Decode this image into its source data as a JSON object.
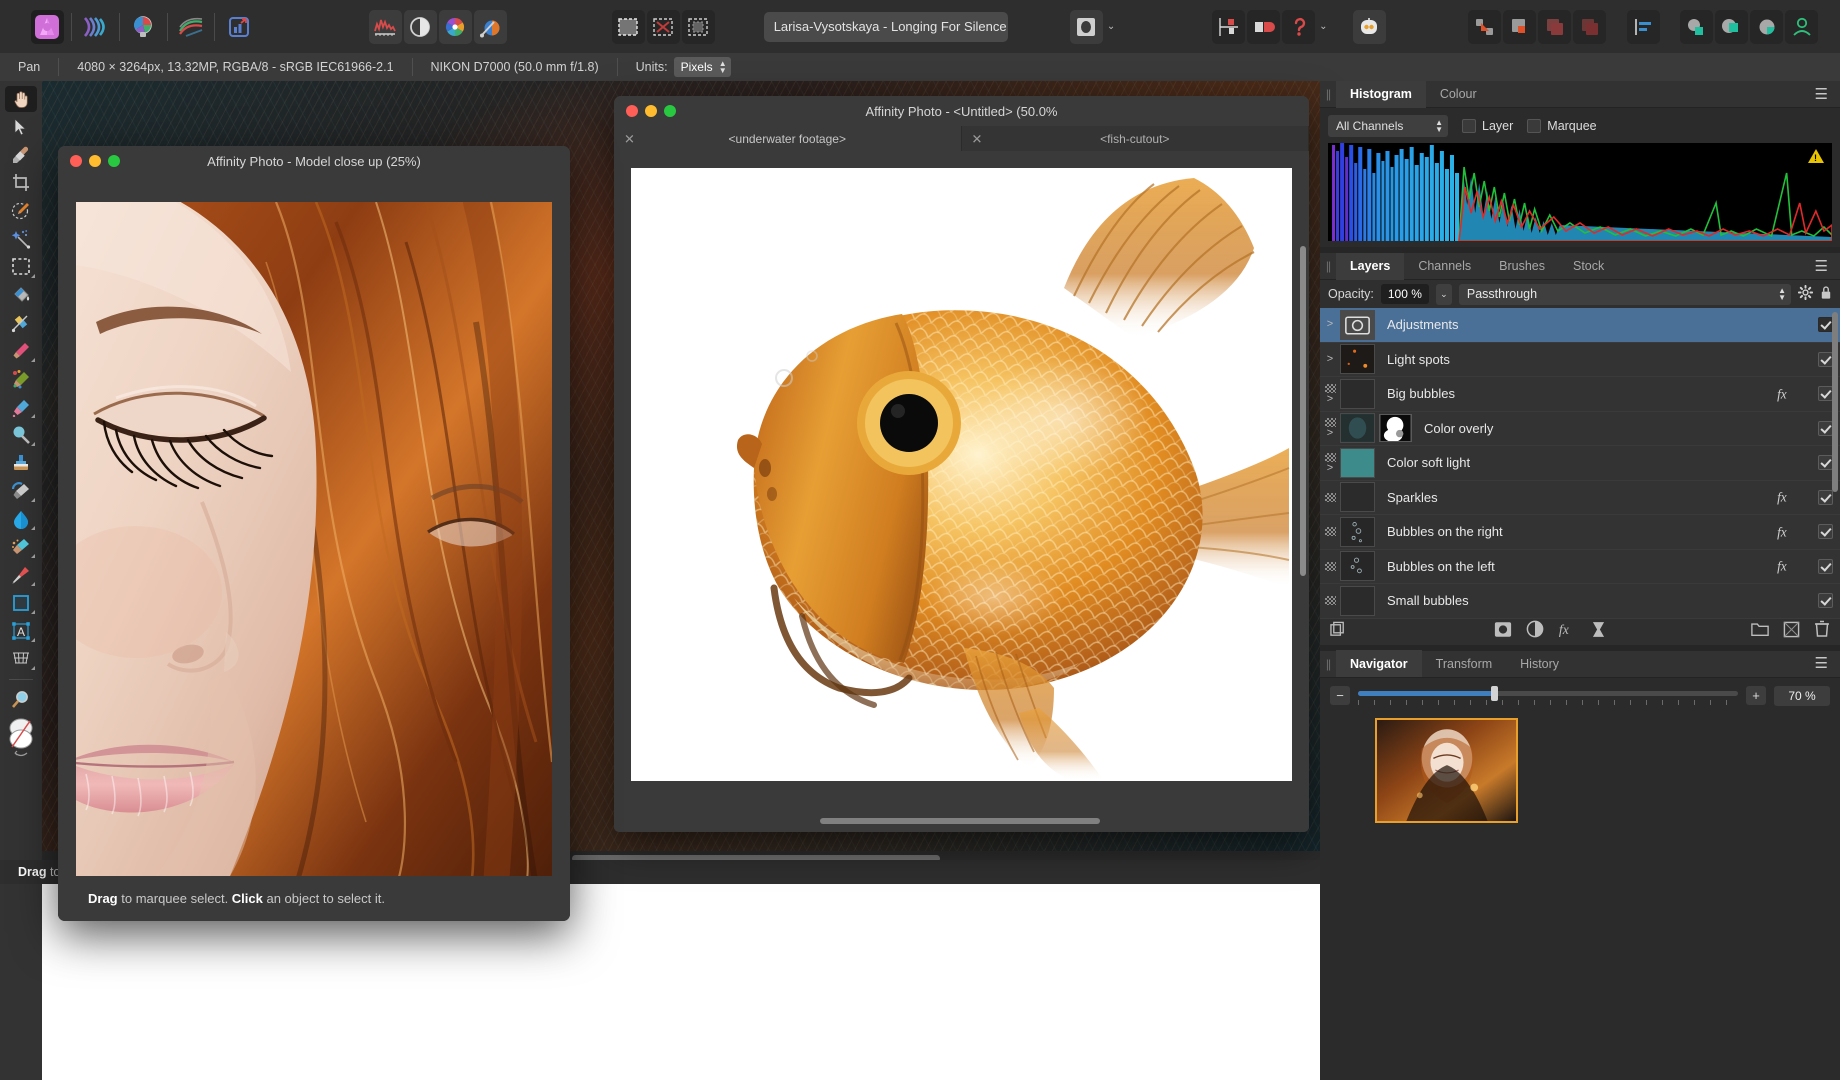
{
  "app": {
    "name": "Affinity Photo"
  },
  "toolbar": {
    "persona_icons": [
      "affinity-photo-persona",
      "liquify-persona",
      "develop-persona",
      "tone-mapping-persona",
      "export-persona"
    ],
    "studio_icons": [
      "histogram-icon",
      "adjustment-icon",
      "colour-wheel-icon",
      "colour-picker-icon"
    ],
    "selection_icons": [
      "select-all-icon",
      "deselect-icon",
      "invert-selection-icon"
    ],
    "document_chip": {
      "label": "Larisa-Vysotskaya - Longing For Silence (",
      "modified_marker": "✱"
    },
    "blend_icon": "blend-ranges-icon",
    "arrange_icons": [
      "snapping-icon",
      "contrast-icon",
      "assistant-icon"
    ],
    "assistant_icon": "assistant-robot-icon",
    "boolean_icons": [
      "align-icon",
      "combine-icon",
      "subtract-icon",
      "intersect-icon"
    ],
    "distribute_icon": "distribute-icon",
    "geometry_icons": [
      "add-geometry-icon",
      "subtract-geometry-icon",
      "divide-geometry-icon"
    ],
    "account_icon": "account-person-icon"
  },
  "context_bar": {
    "tool_name": "Pan",
    "document_info": "4080 × 3264px, 13.32MP, RGBA/8 - sRGB IEC61966-2.1",
    "camera_info": "NIKON D7000 (50.0 mm f/1.8)",
    "units_label": "Units:",
    "units_value": "Pixels"
  },
  "tools": [
    {
      "name": "view-pan-tool",
      "selected": true
    },
    {
      "name": "move-tool",
      "selected": false
    },
    {
      "name": "colour-picker-tool",
      "selected": false
    },
    {
      "name": "crop-tool",
      "selected": false
    },
    {
      "name": "selection-brush-tool",
      "selected": false
    },
    {
      "name": "flood-select-tool",
      "selected": false
    },
    {
      "name": "marquee-selection-tool",
      "selected": false
    },
    {
      "name": "flood-fill-tool",
      "selected": false
    },
    {
      "name": "gradient-tool",
      "selected": false
    },
    {
      "name": "paint-brush-tool",
      "selected": false
    },
    {
      "name": "paint-mixer-brush-tool",
      "selected": false
    },
    {
      "name": "erase-brush-tool",
      "selected": false
    },
    {
      "name": "dodge-brush-tool",
      "selected": false
    },
    {
      "name": "clone-brush-tool",
      "selected": false
    },
    {
      "name": "smudge-brush-tool",
      "selected": false
    },
    {
      "name": "blur-brush-tool",
      "selected": false
    },
    {
      "name": "sponge-brush-tool",
      "selected": false
    },
    {
      "name": "pen-tool",
      "selected": false
    },
    {
      "name": "rectangle-tool",
      "selected": false
    },
    {
      "name": "artistic-text-tool",
      "selected": false
    },
    {
      "name": "mesh-warp-tool",
      "selected": false
    },
    {
      "name": "zoom-tool",
      "selected": false
    },
    {
      "name": "colour-swatch-tool",
      "selected": false
    }
  ],
  "app_status": {
    "hint": "Drag to p"
  },
  "windows": {
    "model": {
      "title": "Affinity Photo - Model close up (25%)",
      "zoom": "25%",
      "status_strong_1": "Drag",
      "status_text_1": " to marquee select. ",
      "status_strong_2": "Click",
      "status_text_2": " an object to select it."
    },
    "fish": {
      "title": "Affinity Photo - <Untitled> (50.0%",
      "tabs": [
        {
          "label": "<underwater footage>",
          "active": true
        },
        {
          "label": "<fish-cutout>",
          "active": false
        }
      ]
    }
  },
  "right_panel": {
    "histogram_panel": {
      "tabs": [
        {
          "label": "Histogram",
          "active": true
        },
        {
          "label": "Colour",
          "active": false
        }
      ],
      "channel_select": "All Channels",
      "checkboxes": [
        {
          "label": "Layer",
          "checked": false
        },
        {
          "label": "Marquee",
          "checked": false
        }
      ],
      "warning_icon": "clipping-warning-icon",
      "menu_icon": "panel-menu-icon"
    },
    "layers_panel": {
      "tabs": [
        {
          "label": "Layers",
          "active": true
        },
        {
          "label": "Channels",
          "active": false
        },
        {
          "label": "Brushes",
          "active": false
        },
        {
          "label": "Stock",
          "active": false
        }
      ],
      "opacity_label": "Opacity:",
      "opacity_value": "100 %",
      "blend_mode": "Passthrough",
      "gear_icon": "layer-settings-icon",
      "lock_icon": "lock-icon",
      "menu_icon": "panel-menu-icon",
      "layers": [
        {
          "name": "Adjustments",
          "selected": true,
          "visible": true,
          "fx": false,
          "expandable": true,
          "masked": false,
          "thumb": "adjustment",
          "extra_thumb": false
        },
        {
          "name": "Light spots",
          "selected": false,
          "visible": true,
          "fx": false,
          "expandable": true,
          "masked": false,
          "thumb": "lightspots",
          "extra_thumb": false
        },
        {
          "name": "Big bubbles",
          "selected": false,
          "visible": true,
          "fx": true,
          "expandable": true,
          "masked": true,
          "thumb": "dark",
          "extra_thumb": false
        },
        {
          "name": "Color overly",
          "selected": false,
          "visible": true,
          "fx": false,
          "expandable": true,
          "masked": true,
          "thumb": "teal-dark",
          "extra_thumb": true
        },
        {
          "name": "Color soft light",
          "selected": false,
          "visible": true,
          "fx": false,
          "expandable": true,
          "masked": true,
          "thumb": "teal",
          "extra_thumb": false
        },
        {
          "name": "Sparkles",
          "selected": false,
          "visible": true,
          "fx": true,
          "expandable": false,
          "masked": true,
          "thumb": "dark",
          "extra_thumb": false
        },
        {
          "name": "Bubbles on the right",
          "selected": false,
          "visible": true,
          "fx": true,
          "expandable": false,
          "masked": true,
          "thumb": "bubbles-r",
          "extra_thumb": false
        },
        {
          "name": "Bubbles on the left",
          "selected": false,
          "visible": true,
          "fx": true,
          "expandable": false,
          "masked": true,
          "thumb": "bubbles-l",
          "extra_thumb": false
        },
        {
          "name": "Small bubbles",
          "selected": false,
          "visible": true,
          "fx": false,
          "expandable": false,
          "masked": true,
          "thumb": "dark",
          "extra_thumb": false
        }
      ],
      "toolbar_icons": [
        "duplicate-layer-icon",
        "mask-layer-icon",
        "adjustment-layer-icon",
        "live-filter-icon",
        "pixel-layer-icon",
        "new-group-icon",
        "new-layer-icon",
        "delete-layer-icon"
      ]
    },
    "navigator_panel": {
      "tabs": [
        {
          "label": "Navigator",
          "active": true
        },
        {
          "label": "Transform",
          "active": false
        },
        {
          "label": "History",
          "active": false
        }
      ],
      "zoom_out_icon": "minus-icon",
      "zoom_in_icon": "plus-icon",
      "zoom_value": "70 %",
      "menu_icon": "panel-menu-icon"
    }
  },
  "colors": {
    "selection_blue": "#4a7098",
    "panel_bg": "#2b2b2b",
    "toolbar_bg": "#2e2e2e",
    "accent_orange": "#e8a02a",
    "warning_yellow": "#e8c400"
  }
}
